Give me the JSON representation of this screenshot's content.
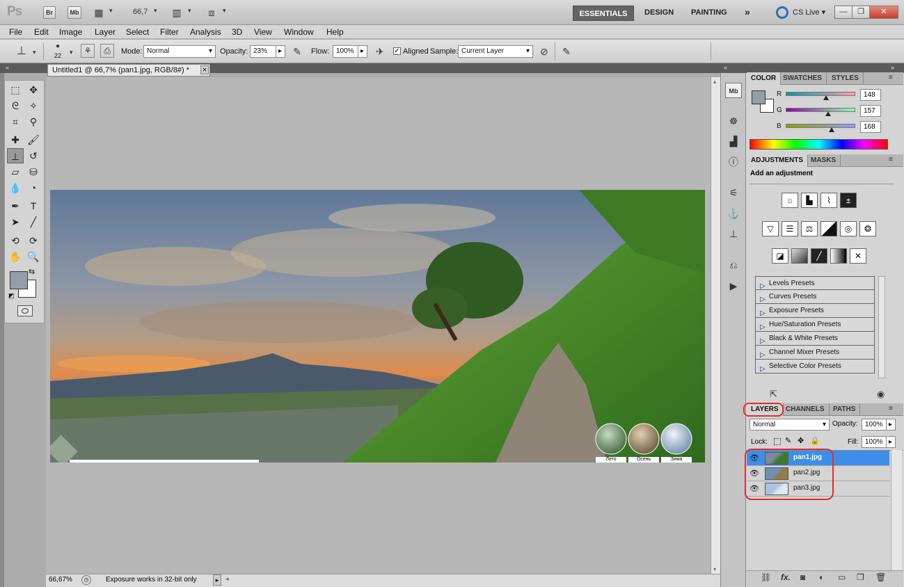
{
  "app": {
    "logo": "Ps",
    "bridge_btn": "Br",
    "minibridge_btn": "Mb",
    "zoom": "66,7",
    "workspaces": [
      "ESSENTIALS",
      "DESIGN",
      "PAINTING"
    ],
    "more_workspaces": "»",
    "cs_live": "CS Live",
    "cs_live_arrow": "▾",
    "win_min": "—",
    "win_restore": "❐",
    "win_close": "✕"
  },
  "menu": [
    "File",
    "Edit",
    "Image",
    "Layer",
    "Select",
    "Filter",
    "Analysis",
    "3D",
    "View",
    "Window",
    "Help"
  ],
  "options": {
    "brush_size": "22",
    "mode_label": "Mode:",
    "mode_value": "Normal",
    "opacity_label": "Opacity:",
    "opacity_value": "23%",
    "flow_label": "Flow:",
    "flow_value": "100%",
    "aligned_label": "Aligned",
    "aligned_check": "✓",
    "sample_label": "Sample:",
    "sample_value": "Current Layer",
    "dropdown_arrow": "▾",
    "step_arrow": "▸"
  },
  "document": {
    "tab_title": "Untitled1 @ 66,7% (pan1.jpg, RGB/8#) *",
    "tab_close": "✕",
    "collapse_left": "«",
    "collapse_right": "»",
    "photo_thumb_labels": [
      "Лето",
      "Осень",
      "Зима"
    ]
  },
  "status": {
    "zoom": "66,67%",
    "message": "Exposure works in 32-bit only",
    "arrow": "▸",
    "left_arrow": "◂"
  },
  "colors": {
    "foreground": "#949da8",
    "background": "#ffffff",
    "accent_selection": "#3d8ee8",
    "annotation": "#e32c2c"
  },
  "color_panel": {
    "tabs": [
      "COLOR",
      "SWATCHES",
      "STYLES"
    ],
    "channels": [
      {
        "label": "R",
        "value": "148",
        "fraction": 0.58
      },
      {
        "label": "G",
        "value": "157",
        "fraction": 0.615
      },
      {
        "label": "B",
        "value": "168",
        "fraction": 0.66
      }
    ]
  },
  "adjustments_panel": {
    "tabs": [
      "ADJUSTMENTS",
      "MASKS"
    ],
    "heading": "Add an adjustment",
    "presets": [
      "Levels Presets",
      "Curves Presets",
      "Exposure Presets",
      "Hue/Saturation Presets",
      "Black & White Presets",
      "Channel Mixer Presets",
      "Selective Color Presets"
    ]
  },
  "layers_panel": {
    "tabs": [
      "LAYERS",
      "CHANNELS",
      "PATHS"
    ],
    "blend_mode": "Normal",
    "opacity_label": "Opacity:",
    "opacity_value": "100%",
    "lock_label": "Lock:",
    "fill_label": "Fill:",
    "fill_value": "100%",
    "layers": [
      {
        "name": "pan1.jpg",
        "selected": true
      },
      {
        "name": "pan2.jpg",
        "selected": false
      },
      {
        "name": "pan3.jpg",
        "selected": false
      }
    ],
    "footer_fx": "fx."
  },
  "icons": {
    "eye": "👁",
    "menu_arrow": "▾",
    "panel_menu": "≡"
  }
}
